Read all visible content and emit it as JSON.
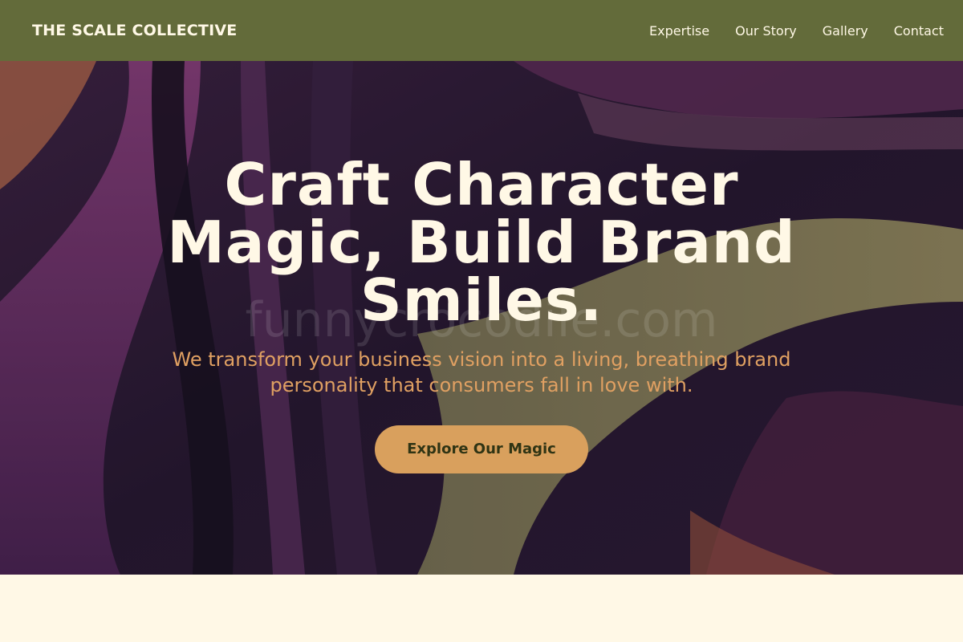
{
  "header": {
    "brand": "THE SCALE COLLECTIVE",
    "nav": [
      {
        "label": "Expertise"
      },
      {
        "label": "Our Story"
      },
      {
        "label": "Gallery"
      },
      {
        "label": "Contact"
      }
    ]
  },
  "hero": {
    "headline": "Craft Character Magic, Build Brand Smiles.",
    "watermark": "funnycrocodile.com",
    "subheadline": "We transform your business vision into a living, breathing brand personality that consumers fall in love with.",
    "cta_label": "Explore Our Magic"
  },
  "colors": {
    "header_bg": "#636b3a",
    "headline": "#fff8e6",
    "subheadline": "#e0a062",
    "cta_bg": "#d9a05d",
    "cta_text": "#2f3414",
    "page_bg": "#fff8e6"
  }
}
